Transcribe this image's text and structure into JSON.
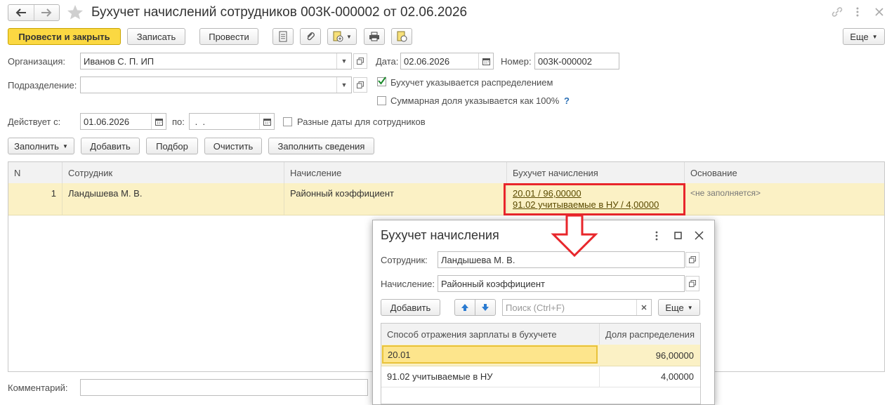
{
  "window": {
    "title": "Бухучет начислений сотрудников 003К-000002 от 02.06.2026"
  },
  "toolbar": {
    "post_close": "Провести и закрыть",
    "save": "Записать",
    "post": "Провести",
    "more": "Еще"
  },
  "form": {
    "org_label": "Организация:",
    "org_value": "Иванов С. П. ИП",
    "date_label": "Дата:",
    "date_value": "02.06.2026",
    "number_label": "Номер:",
    "number_value": "003К-000002",
    "dept_label": "Подразделение:",
    "dept_value": "",
    "cb_distribution": "Бухучет указывается распределением",
    "cb_distribution_checked": true,
    "cb_total": "Суммарная доля указывается как 100%",
    "cb_total_checked": false,
    "help": "?",
    "valid_from_label": "Действует с:",
    "valid_from_value": "01.06.2026",
    "to_label": "по:",
    "to_value": " .  .",
    "cb_diff_dates": "Разные даты для сотрудников",
    "cb_diff_dates_checked": false
  },
  "table_toolbar": {
    "fill": "Заполнить",
    "add": "Добавить",
    "select": "Подбор",
    "clear": "Очистить",
    "fill_info": "Заполнить сведения"
  },
  "table": {
    "columns": [
      "N",
      "Сотрудник",
      "Начисление",
      "Бухучет начисления",
      "Основание"
    ],
    "rows": [
      {
        "n": "1",
        "employee": "Ландышева М. В.",
        "accrual": "Районный коэффициент",
        "acc_line1": "20.01 / 96,00000",
        "acc_line2": "91.02 учитываемые в НУ / 4,00000",
        "basis": "<не заполняется>"
      }
    ]
  },
  "comment": {
    "label": "Комментарий:",
    "value": ""
  },
  "dialog": {
    "title": "Бухучет начисления",
    "employee_label": "Сотрудник:",
    "employee_value": "Ландышева М. В.",
    "accrual_label": "Начисление:",
    "accrual_value": "Районный коэффициент",
    "add": "Добавить",
    "search_placeholder": "Поиск (Ctrl+F)",
    "more": "Еще",
    "columns": [
      "Способ отражения зарплаты в бухучете",
      "Доля распределения"
    ],
    "rows": [
      {
        "method": "20.01",
        "share": "96,00000"
      },
      {
        "method": "91.02 учитываемые в НУ",
        "share": "4,00000"
      }
    ]
  },
  "colors": {
    "primary_button": "#fbd842",
    "selected_row": "#fbf1c5",
    "highlight_red": "#e8262b",
    "selected_cell": "#fde58c"
  }
}
